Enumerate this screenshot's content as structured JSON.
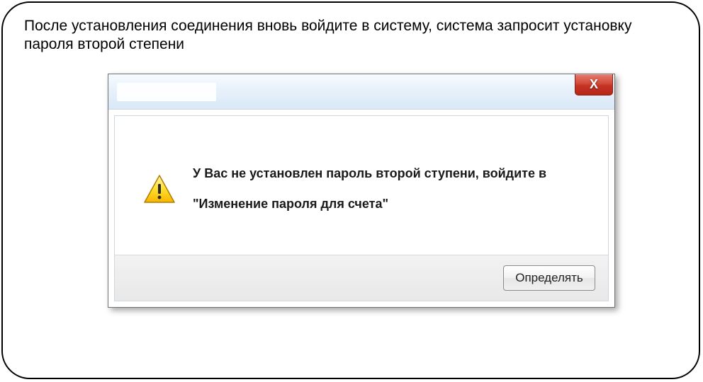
{
  "instruction": "После установления соединения вновь войдите в систему, система запросит установку пароля второй степени",
  "dialog": {
    "close_label": "X",
    "message": "У Вас не установлен пароль второй ступени, войдите в \"Изменение пароля для счета\"",
    "confirm_label": "Определять"
  }
}
